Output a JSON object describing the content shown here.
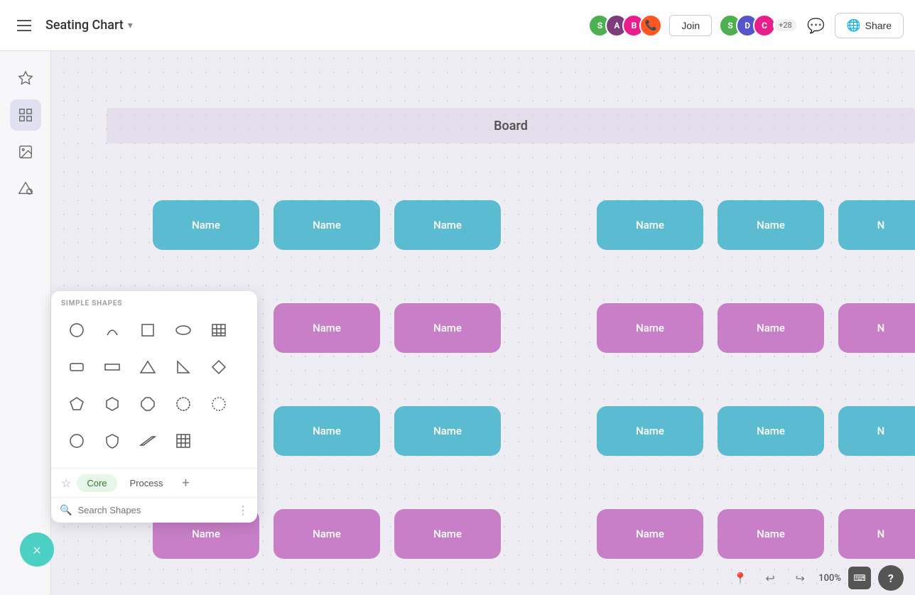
{
  "header": {
    "menu_label": "menu",
    "title": "Seating Chart",
    "join_label": "Join",
    "share_label": "Share",
    "avatars": [
      {
        "id": "av1",
        "letter": "S",
        "color": "#4CAF50"
      },
      {
        "id": "av2",
        "letter": "A",
        "color": "#9c3c7e"
      },
      {
        "id": "av3",
        "letter": "B",
        "color": "#e91e8c"
      },
      {
        "id": "av4",
        "letter": "📞",
        "color": "#ff5722"
      }
    ],
    "avatar_group2": [
      {
        "id": "av5",
        "letter": "S",
        "color": "#4CAF50"
      },
      {
        "id": "av6",
        "letter": "D",
        "color": "#5555cc"
      },
      {
        "id": "av7",
        "letter": "C",
        "color": "#e91e8c"
      }
    ],
    "extra_count": "+28"
  },
  "board": {
    "title": "Board"
  },
  "seats": {
    "row1_blue": [
      "Name",
      "Name",
      "Name",
      "Name",
      "Name"
    ],
    "row2_pink": [
      "Name",
      "Name",
      "Name",
      "Name"
    ],
    "row3_blue": [
      "Name",
      "Name",
      "Name",
      "Name"
    ],
    "row4_pink": [
      "Name",
      "Name",
      "Name",
      "Name"
    ],
    "row5_partial_blue": [
      "Name"
    ],
    "row5_partial_pink": [
      "Name",
      "Name"
    ]
  },
  "shapes_panel": {
    "section_label": "SIMPLE SHAPES",
    "tabs": [
      "Core",
      "Process"
    ],
    "active_tab": "Core",
    "search_placeholder": "Search Shapes"
  },
  "sidebar": {
    "icons": [
      "⭐",
      "⊞",
      "🖼",
      "∞"
    ]
  },
  "zoom": "100%",
  "close_icon": "×",
  "help_icon": "?"
}
